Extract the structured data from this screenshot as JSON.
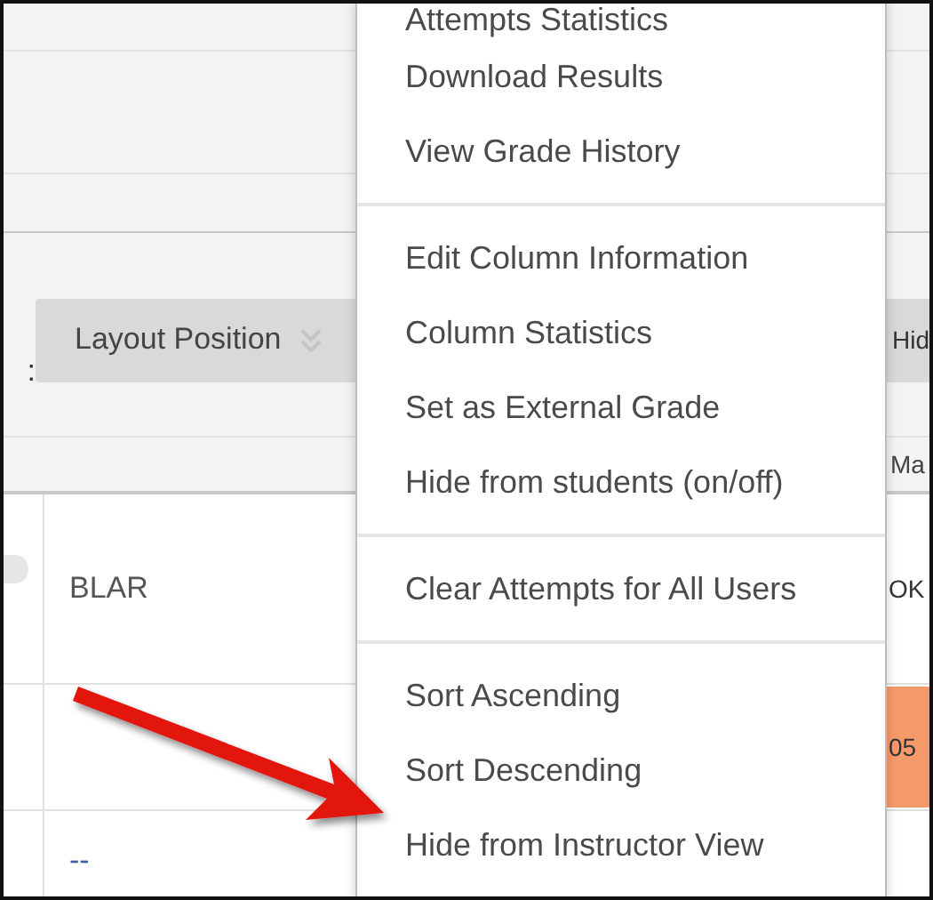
{
  "toolbar": {
    "sort_label": ":",
    "sort_button": "Layout Position",
    "column_header": "Hid",
    "column_subheader": "Ma"
  },
  "table": {
    "rows": [
      {
        "column_2": "BLAR",
        "column_4": "OK",
        "highlighted": false,
        "icon": true
      },
      {
        "column_4": "05",
        "highlighted": true,
        "icon": false
      },
      {
        "column_2": "--",
        "highlighted": false,
        "icon": false
      }
    ]
  },
  "context_menu": {
    "groups": [
      {
        "items": [
          {
            "label": "Attempts Statistics"
          },
          {
            "label": "Download Results"
          },
          {
            "label": "View Grade History"
          }
        ]
      },
      {
        "items": [
          {
            "label": "Edit Column Information"
          },
          {
            "label": "Column Statistics"
          },
          {
            "label": "Set as External Grade"
          },
          {
            "label": "Hide from students (on/off)"
          }
        ]
      },
      {
        "items": [
          {
            "label": "Clear Attempts for All Users"
          }
        ]
      },
      {
        "items": [
          {
            "label": "Sort Ascending"
          },
          {
            "label": "Sort Descending"
          },
          {
            "label": "Hide from Instructor View"
          }
        ]
      }
    ]
  }
}
